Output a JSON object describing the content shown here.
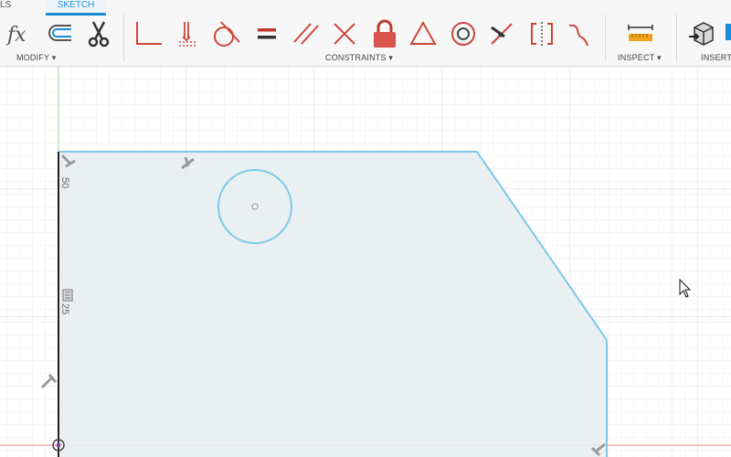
{
  "tabs": {
    "partial_label": "LS",
    "sketch_label": "SKETCH"
  },
  "groups": {
    "modify": "MODIFY ▾",
    "constraints": "CONSTRAINTS ▾",
    "inspect": "INSPECT ▾",
    "insert": "INSERT"
  },
  "tools": [
    "fx-parameters-icon",
    "offset-icon",
    "trim-scissors-icon",
    "coincident-icon",
    "collinear-icon",
    "tangent-icon",
    "equal-icon",
    "parallel-icon",
    "perpendicular-icon",
    "fix-lock-icon",
    "midpoint-icon",
    "concentric-icon",
    "horizontal-vertical-icon",
    "symmetry-icon",
    "curvature-icon",
    "measure-icon",
    "insert-box-icon"
  ],
  "sketch": {
    "dimension_top": "50",
    "dimension_mid": "25"
  },
  "colors": {
    "sketch_line": "#7ec8ea",
    "constraint_red": "#d0453b",
    "tab_active": "#1c8cd7",
    "fill": "#eef2f4"
  }
}
